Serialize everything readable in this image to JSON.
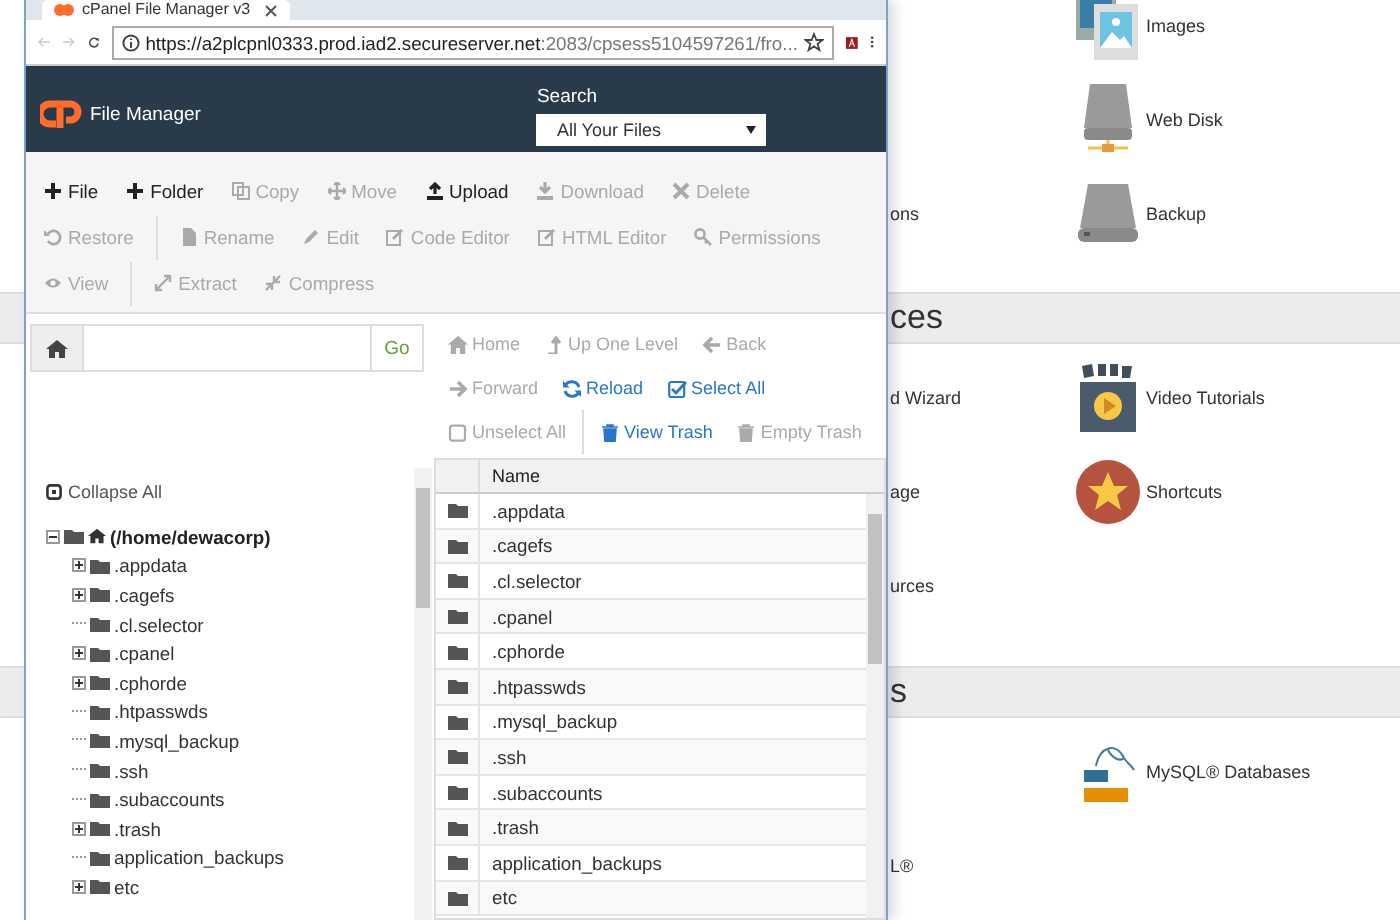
{
  "background": {
    "sections": [
      {
        "items": [
          {
            "label": "Images"
          },
          {
            "label": "Web Disk"
          },
          {
            "fragment": "ons",
            "label": "Backup"
          }
        ]
      },
      {
        "heading": "ces",
        "items": [
          {
            "fragment": "d Wizard",
            "label": "Video Tutorials"
          },
          {
            "fragment": "age",
            "label": "Shortcuts"
          },
          {
            "fragment": "urces"
          }
        ]
      },
      {
        "heading": "s",
        "items": [
          {
            "label": "MySQL® Databases"
          },
          {
            "fragment": "L®"
          }
        ]
      }
    ]
  },
  "browser": {
    "tab_title": "cPanel File Manager v3",
    "url_host": "https://a2plcpnl0333.prod.iad2.secureserver.net",
    "url_rest": ":2083/cpsess5104597261/fro..."
  },
  "header": {
    "app_name": "File Manager",
    "search_label": "Search",
    "search_scope": "All Your Files"
  },
  "toolbar": [
    {
      "items": [
        {
          "label": "File",
          "disabled": false
        },
        {
          "label": "Folder",
          "disabled": false
        },
        {
          "label": "Copy",
          "disabled": true
        },
        {
          "label": "Move",
          "disabled": true
        },
        {
          "label": "Upload",
          "disabled": false
        },
        {
          "label": "Download",
          "disabled": true
        },
        {
          "label": "Delete",
          "disabled": true
        }
      ]
    },
    {
      "items": [
        {
          "label": "Restore",
          "disabled": true
        },
        {
          "label": "Rename",
          "disabled": true
        },
        {
          "label": "Edit",
          "disabled": true
        },
        {
          "label": "Code Editor",
          "disabled": true
        },
        {
          "label": "HTML Editor",
          "disabled": true
        },
        {
          "label": "Permissions",
          "disabled": true
        }
      ]
    },
    {
      "items": [
        {
          "label": "View",
          "disabled": true
        },
        {
          "label": "Extract",
          "disabled": true
        },
        {
          "label": "Compress",
          "disabled": true
        }
      ]
    }
  ],
  "path_bar": {
    "go": "Go"
  },
  "nav": [
    {
      "items": [
        {
          "label": "Home",
          "disabled": true
        },
        {
          "label": "Up One Level",
          "disabled": true
        },
        {
          "label": "Back",
          "disabled": true
        }
      ]
    },
    {
      "items": [
        {
          "label": "Forward",
          "disabled": true
        },
        {
          "label": "Reload",
          "disabled": false
        },
        {
          "label": "Select All",
          "disabled": false
        }
      ]
    },
    {
      "items": [
        {
          "label": "Unselect All",
          "disabled": true
        },
        {
          "label": "View Trash",
          "disabled": false
        },
        {
          "label": "Empty Trash",
          "disabled": true
        }
      ]
    }
  ],
  "tree": {
    "collapse_all": "Collapse All",
    "root": {
      "label": "(/home/dewacorp)",
      "expanded": true,
      "children": [
        {
          "label": ".appdata",
          "expandable": true
        },
        {
          "label": ".cagefs",
          "expandable": true
        },
        {
          "label": ".cl.selector",
          "expandable": false
        },
        {
          "label": ".cpanel",
          "expandable": true
        },
        {
          "label": ".cphorde",
          "expandable": true
        },
        {
          "label": ".htpasswds",
          "expandable": false
        },
        {
          "label": ".mysql_backup",
          "expandable": false
        },
        {
          "label": ".ssh",
          "expandable": false
        },
        {
          "label": ".subaccounts",
          "expandable": false
        },
        {
          "label": ".trash",
          "expandable": true
        },
        {
          "label": "application_backups",
          "expandable": false
        },
        {
          "label": "etc",
          "expandable": true
        }
      ]
    }
  },
  "table": {
    "columns": [
      "Name"
    ],
    "rows": [
      {
        "name": ".appdata"
      },
      {
        "name": ".cagefs"
      },
      {
        "name": ".cl.selector"
      },
      {
        "name": ".cpanel"
      },
      {
        "name": ".cphorde"
      },
      {
        "name": ".htpasswds"
      },
      {
        "name": ".mysql_backup"
      },
      {
        "name": ".ssh"
      },
      {
        "name": ".subaccounts"
      },
      {
        "name": ".trash"
      },
      {
        "name": "application_backups"
      },
      {
        "name": "etc"
      }
    ]
  }
}
